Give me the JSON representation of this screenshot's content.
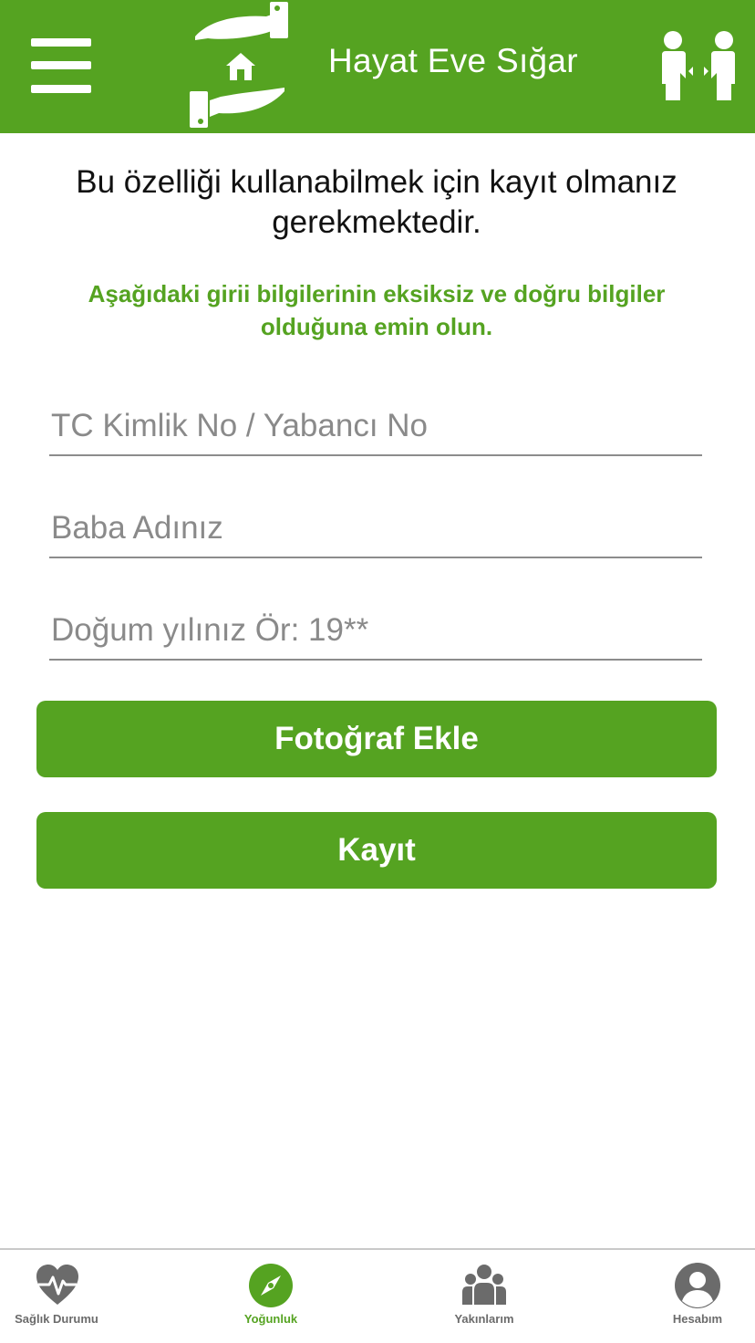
{
  "header": {
    "title": "Hayat Eve Sığar",
    "menu_icon": "hamburger-menu-icon",
    "logo_icon": "hands-house-logo",
    "action_icon": "social-distance-icon"
  },
  "main": {
    "intro_text": "Bu özelliği kullanabilmek için kayıt olmanız gerekmektedir.",
    "warning_text": "Aşağıdaki girii bilgilerinin eksiksiz ve doğru bilgiler olduğuna emin olun.",
    "fields": [
      {
        "placeholder": "TC Kimlik No / Yabancı No",
        "value": ""
      },
      {
        "placeholder": "Baba Adınız",
        "value": ""
      },
      {
        "placeholder": "Doğum yılınız Ör: 19**",
        "value": ""
      }
    ],
    "buttons": {
      "add_photo": "Fotoğraf Ekle",
      "register": "Kayıt"
    }
  },
  "bottom_nav": {
    "items": [
      {
        "label": "Sağlık Durumu",
        "icon": "heart-pulse-icon",
        "active": false
      },
      {
        "label": "Yoğunluk",
        "icon": "compass-icon",
        "active": true
      },
      {
        "label": "Yakınlarım",
        "icon": "group-icon",
        "active": false
      },
      {
        "label": "Hesabım",
        "icon": "user-circle-icon",
        "active": false
      }
    ]
  },
  "colors": {
    "brand_green": "#55a321",
    "inactive_icon": "#6b6b6b",
    "text": "#111111"
  }
}
